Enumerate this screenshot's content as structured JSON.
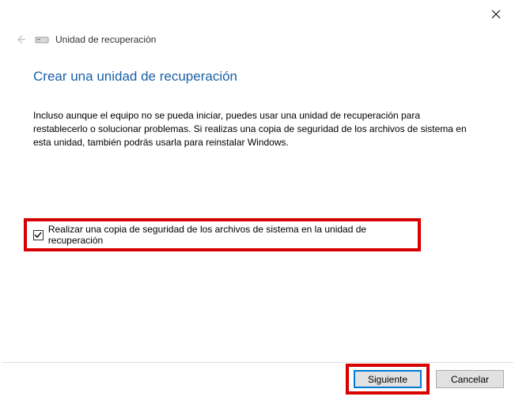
{
  "window": {
    "title": "Unidad de recuperación"
  },
  "heading": "Crear una unidad de recuperación",
  "body_text": "Incluso aunque el equipo no se pueda iniciar, puedes usar una unidad de recuperación para restablecerlo o solucionar problemas. Si realizas una copia de seguridad de los archivos de sistema en esta unidad, también podrás usarla para reinstalar Windows.",
  "checkbox": {
    "label": "Realizar una copia de seguridad de los archivos de sistema en la unidad de recuperación",
    "checked": true
  },
  "buttons": {
    "next": "Siguiente",
    "cancel": "Cancelar"
  },
  "colors": {
    "highlight": "#d80000",
    "heading": "#1a5fa8",
    "primary_border": "#0078d7"
  }
}
